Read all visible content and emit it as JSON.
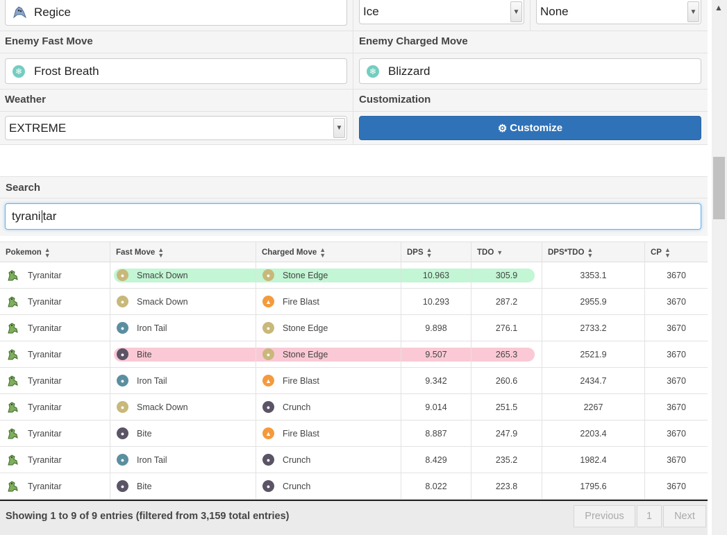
{
  "top": {
    "pokemon": "Regice",
    "type1": "Ice",
    "type2": "None"
  },
  "enemy": {
    "fast_label": "Enemy Fast Move",
    "fast_value": "Frost Breath",
    "charged_label": "Enemy Charged Move",
    "charged_value": "Blizzard"
  },
  "settings": {
    "weather_label": "Weather",
    "weather_value": "EXTREME",
    "custom_label": "Customization",
    "customize_button": "Customize"
  },
  "search": {
    "label": "Search",
    "value_before_caret": "tyrani",
    "value_after_caret": "tar"
  },
  "table": {
    "columns": [
      "Pokemon",
      "Fast Move",
      "Charged Move",
      "DPS",
      "TDO",
      "DPS*TDO",
      "CP"
    ],
    "sorted_column": "TDO",
    "rows": [
      {
        "pokemon": "Tyranitar",
        "fast": "Smack Down",
        "fast_type": "rock",
        "charged": "Stone Edge",
        "charged_type": "rock",
        "dps": "10.963",
        "tdo": "305.9",
        "dpstdo": "3353.1",
        "cp": "3670",
        "highlight": "green"
      },
      {
        "pokemon": "Tyranitar",
        "fast": "Smack Down",
        "fast_type": "rock",
        "charged": "Fire Blast",
        "charged_type": "fire",
        "dps": "10.293",
        "tdo": "287.2",
        "dpstdo": "2955.9",
        "cp": "3670",
        "highlight": ""
      },
      {
        "pokemon": "Tyranitar",
        "fast": "Iron Tail",
        "fast_type": "steel",
        "charged": "Stone Edge",
        "charged_type": "rock",
        "dps": "9.898",
        "tdo": "276.1",
        "dpstdo": "2733.2",
        "cp": "3670",
        "highlight": ""
      },
      {
        "pokemon": "Tyranitar",
        "fast": "Bite",
        "fast_type": "dark",
        "charged": "Stone Edge",
        "charged_type": "rock",
        "dps": "9.507",
        "tdo": "265.3",
        "dpstdo": "2521.9",
        "cp": "3670",
        "highlight": "red"
      },
      {
        "pokemon": "Tyranitar",
        "fast": "Iron Tail",
        "fast_type": "steel",
        "charged": "Fire Blast",
        "charged_type": "fire",
        "dps": "9.342",
        "tdo": "260.6",
        "dpstdo": "2434.7",
        "cp": "3670",
        "highlight": ""
      },
      {
        "pokemon": "Tyranitar",
        "fast": "Smack Down",
        "fast_type": "rock",
        "charged": "Crunch",
        "charged_type": "dark",
        "dps": "9.014",
        "tdo": "251.5",
        "dpstdo": "2267",
        "cp": "3670",
        "highlight": ""
      },
      {
        "pokemon": "Tyranitar",
        "fast": "Bite",
        "fast_type": "dark",
        "charged": "Fire Blast",
        "charged_type": "fire",
        "dps": "8.887",
        "tdo": "247.9",
        "dpstdo": "2203.4",
        "cp": "3670",
        "highlight": ""
      },
      {
        "pokemon": "Tyranitar",
        "fast": "Iron Tail",
        "fast_type": "steel",
        "charged": "Crunch",
        "charged_type": "dark",
        "dps": "8.429",
        "tdo": "235.2",
        "dpstdo": "1982.4",
        "cp": "3670",
        "highlight": ""
      },
      {
        "pokemon": "Tyranitar",
        "fast": "Bite",
        "fast_type": "dark",
        "charged": "Crunch",
        "charged_type": "dark",
        "dps": "8.022",
        "tdo": "223.8",
        "dpstdo": "1795.6",
        "cp": "3670",
        "highlight": ""
      }
    ]
  },
  "footer": {
    "info": "Showing 1 to 9 of 9 entries (filtered from 3,159 total entries)",
    "previous": "Previous",
    "page": "1",
    "next": "Next"
  },
  "colors": {
    "accent": "#2f72b8",
    "highlight_green": "#78eca0",
    "highlight_red": "#f47896"
  },
  "icons": {
    "sort": "sort-arrows-icon",
    "gear": "gear-icon",
    "ice": "snowflake-icon",
    "rock": "rock-type-icon",
    "steel": "steel-type-icon",
    "dark": "dark-type-icon",
    "fire": "fire-type-icon"
  }
}
